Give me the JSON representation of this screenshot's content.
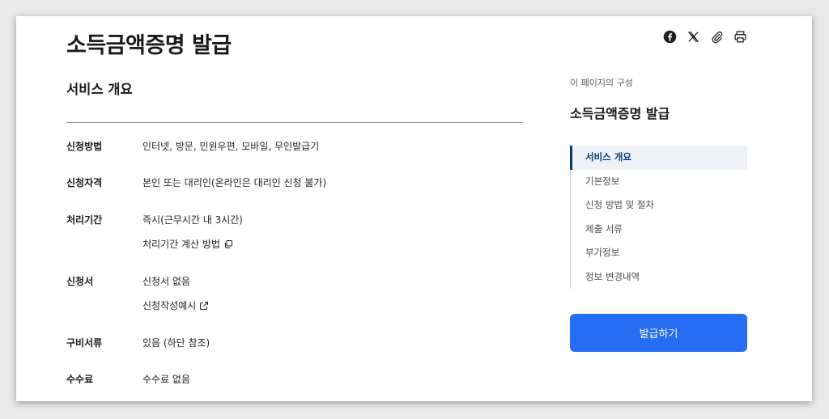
{
  "header": {
    "title": "소득금액증명 발급"
  },
  "share": {
    "icons": [
      "facebook-icon",
      "x-icon",
      "clip-icon",
      "print-icon"
    ]
  },
  "main": {
    "section_title": "서비스 개요",
    "rows": [
      {
        "label": "신청방법",
        "value": "인터넷, 방문, 민원우편, 모바일, 무인발급기"
      },
      {
        "label": "신청자격",
        "value": "본인 또는 대리인(온라인은 대리인 신청 불가)"
      },
      {
        "label": "처리기간",
        "value": "즉시(근무시간 내 3시간)",
        "link": "처리기간 계산 방법"
      },
      {
        "label": "신청서",
        "value": "신청서 없음",
        "link": "신청작성예시"
      },
      {
        "label": "구비서류",
        "value": "있음 (하단 참조)"
      },
      {
        "label": "수수료",
        "value": "수수료 없음"
      }
    ]
  },
  "toc": {
    "caption": "이 페이지의 구성",
    "title": "소득금액증명 발급",
    "items": [
      "서비스 개요",
      "기본정보",
      "신청 방법 및 절차",
      "제출 서류",
      "부가정보",
      "정보 변경내역"
    ],
    "active_index": 0
  },
  "cta": {
    "label": "발급하기",
    "color": "#256ef4"
  }
}
